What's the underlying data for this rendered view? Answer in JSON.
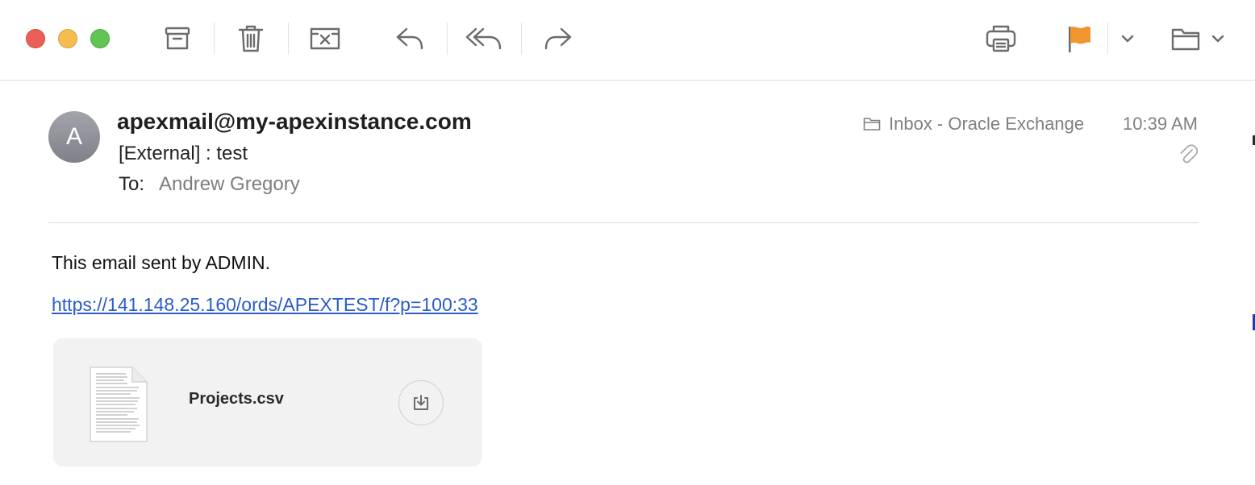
{
  "window_controls": {
    "close_color": "#ec5f58",
    "minimize_color": "#f4bd4f",
    "zoom_color": "#61c554"
  },
  "toolbar": {
    "buttons": [
      {
        "name": "archive",
        "icon": "archive-icon"
      },
      {
        "name": "delete",
        "icon": "trash-icon"
      },
      {
        "name": "junk",
        "icon": "junk-icon"
      },
      {
        "name": "reply",
        "icon": "reply-icon"
      },
      {
        "name": "reply-all",
        "icon": "reply-all-icon"
      },
      {
        "name": "forward",
        "icon": "forward-icon"
      },
      {
        "name": "print",
        "icon": "printer-icon"
      },
      {
        "name": "flag",
        "icon": "flag-icon"
      },
      {
        "name": "flag-menu",
        "icon": "chevron-down-icon"
      },
      {
        "name": "move",
        "icon": "folder-icon"
      }
    ],
    "flag_color": "#f0962e"
  },
  "message": {
    "avatar_initial": "A",
    "from": "apexmail@my-apexinstance.com",
    "subject": "[External] : test",
    "to_label": "To:",
    "to": "Andrew Gregory",
    "mailbox": "Inbox - Oracle Exchange",
    "time": "10:39 AM",
    "body_text": "This email sent by ADMIN.",
    "link": "https://141.148.25.160/ords/APEXTEST/f?p=100:33",
    "link_color": "#2b5cc9"
  },
  "attachment": {
    "file_name": "Projects.csv",
    "icon": "document-icon",
    "action_icon": "download-icon"
  }
}
